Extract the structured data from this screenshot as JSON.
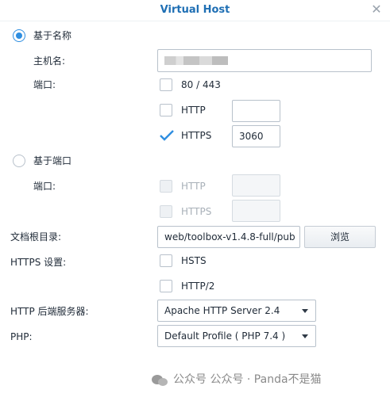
{
  "dialog": {
    "title": "Virtual Host"
  },
  "hostname_mode": {
    "label": "基于名称",
    "hostname_label": "主机名:",
    "port_label": "端口:",
    "port_80_443": "80 / 443",
    "http_label": "HTTP",
    "http_port": "",
    "https_label": "HTTPS",
    "https_port": "3060"
  },
  "port_mode": {
    "label": "基于端口",
    "port_label": "端口:",
    "http_label": "HTTP",
    "https_label": "HTTPS"
  },
  "doc_root": {
    "label": "文档根目录:",
    "value": "web/toolbox-v1.4.8-full/pub",
    "browse_label": "浏览"
  },
  "https_settings": {
    "label": "HTTPS 设置:",
    "hsts_label": "HSTS",
    "http2_label": "HTTP/2"
  },
  "backend": {
    "label": "HTTP 后端服务器:",
    "selected": "Apache HTTP Server 2.4"
  },
  "php": {
    "label": "PHP:",
    "selected": "Default Profile ( PHP 7.4 )"
  },
  "watermark": {
    "text": "公众号 公众号 · Panda不是猫"
  },
  "colors": {
    "accent": "#2f8ee0",
    "title": "#1f6fb4"
  }
}
